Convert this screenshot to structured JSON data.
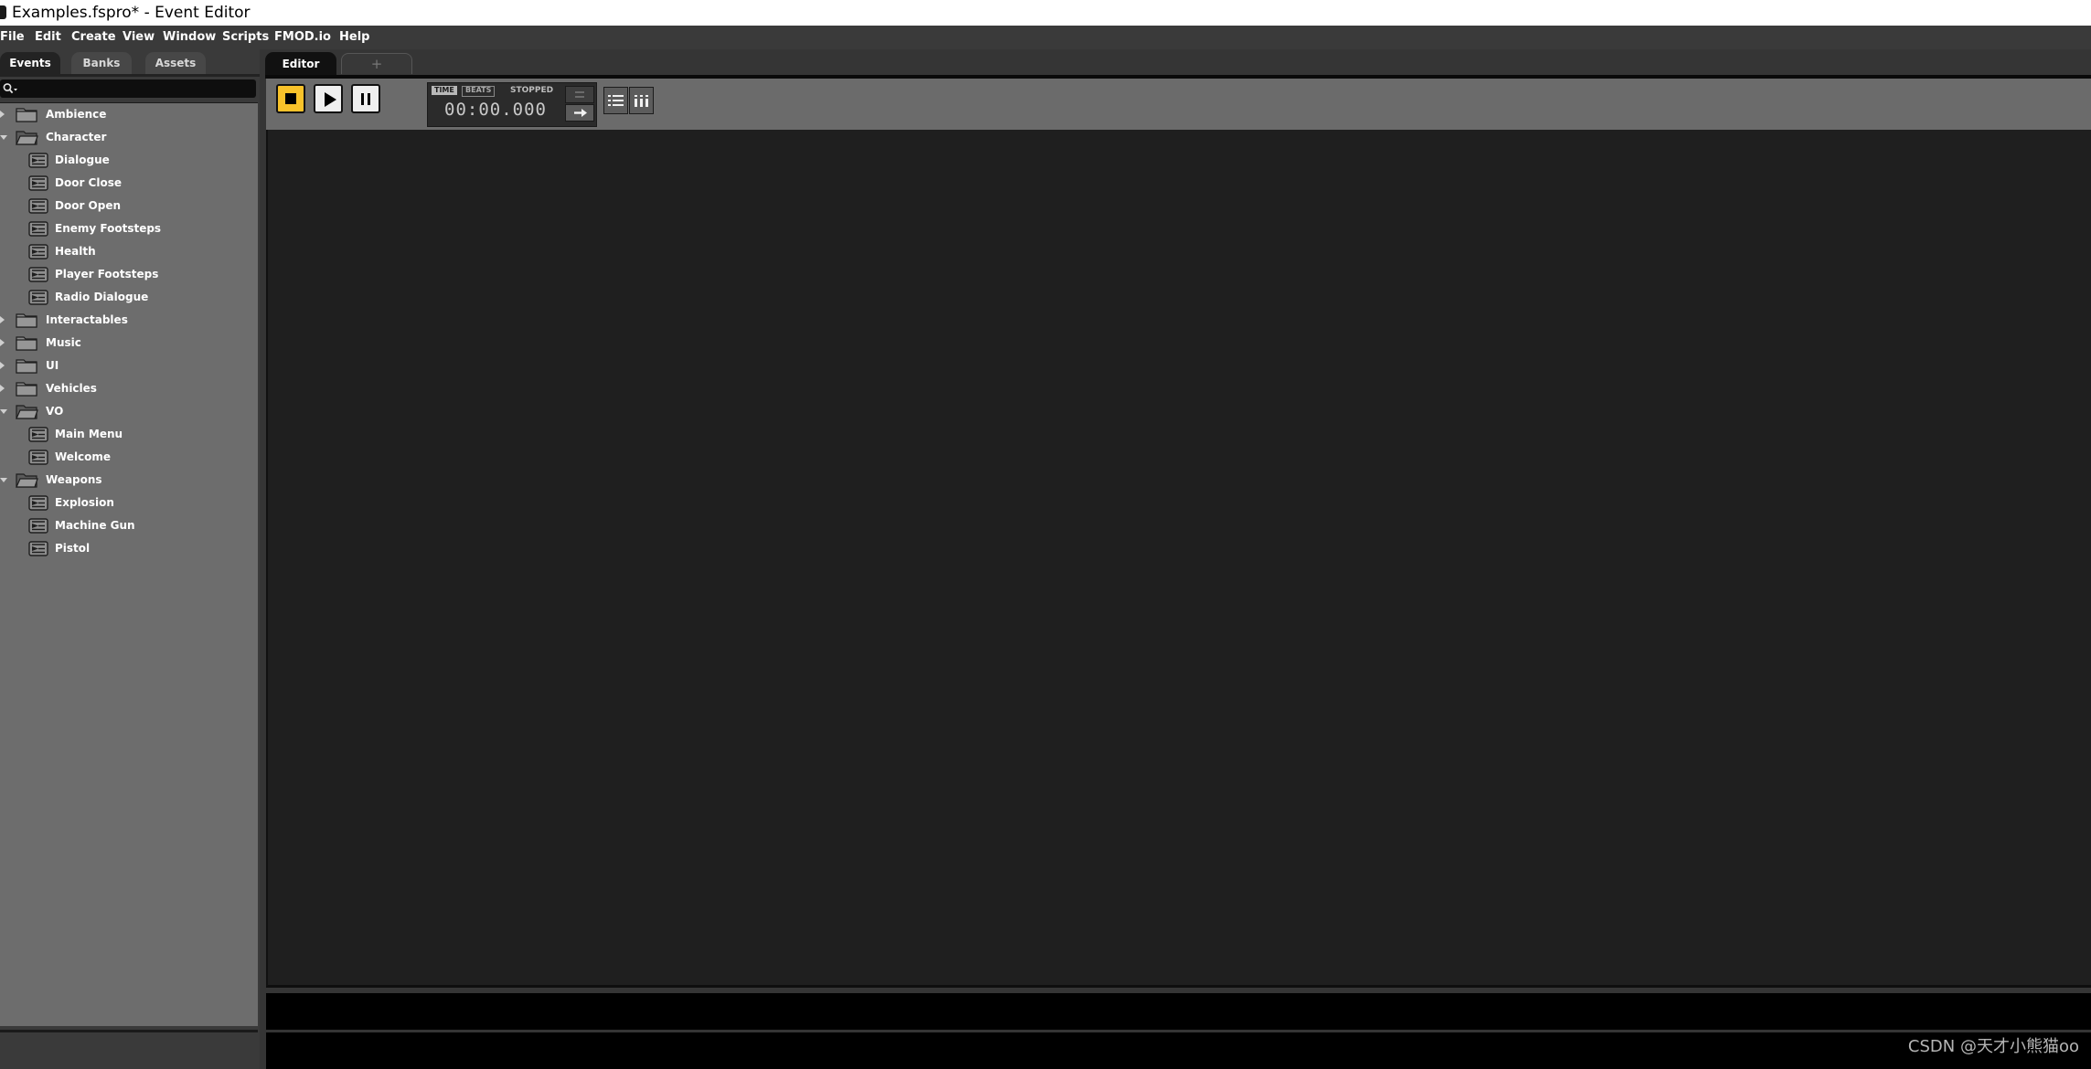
{
  "window": {
    "title": "Examples.fspro* - Event Editor"
  },
  "menu": [
    "File",
    "Edit",
    "Create",
    "View",
    "Window",
    "Scripts",
    "FMOD.io",
    "Help"
  ],
  "browser": {
    "tabs": [
      {
        "label": "Events",
        "active": true
      },
      {
        "label": "Banks",
        "active": false
      },
      {
        "label": "Assets",
        "active": false
      }
    ],
    "search": {
      "value": ""
    },
    "tree": [
      {
        "type": "folder",
        "label": "Ambience",
        "expanded": false
      },
      {
        "type": "folder",
        "label": "Character",
        "expanded": true
      },
      {
        "type": "event",
        "label": "Dialogue"
      },
      {
        "type": "event",
        "label": "Door Close"
      },
      {
        "type": "event",
        "label": "Door Open"
      },
      {
        "type": "event",
        "label": "Enemy Footsteps"
      },
      {
        "type": "event",
        "label": "Health"
      },
      {
        "type": "event",
        "label": "Player Footsteps"
      },
      {
        "type": "event",
        "label": "Radio Dialogue"
      },
      {
        "type": "folder",
        "label": "Interactables",
        "expanded": false
      },
      {
        "type": "folder",
        "label": "Music",
        "expanded": false
      },
      {
        "type": "folder",
        "label": "UI",
        "expanded": false
      },
      {
        "type": "folder",
        "label": "Vehicles",
        "expanded": false
      },
      {
        "type": "folder",
        "label": "VO",
        "expanded": true
      },
      {
        "type": "event",
        "label": "Main Menu"
      },
      {
        "type": "event",
        "label": "Welcome"
      },
      {
        "type": "folder",
        "label": "Weapons",
        "expanded": true
      },
      {
        "type": "event",
        "label": "Explosion"
      },
      {
        "type": "event",
        "label": "Machine Gun"
      },
      {
        "type": "event",
        "label": "Pistol"
      }
    ]
  },
  "editor": {
    "tab_label": "Editor",
    "add_tab_label": "+",
    "transport": {
      "buttons": [
        "stop-icon",
        "play-icon",
        "pause-icon"
      ],
      "time_mode": "TIME",
      "beats_mode": "BEATS",
      "state": "STOPPED",
      "time": "00:00.000"
    },
    "view_buttons": [
      "list-view-icon",
      "columns-view-icon"
    ]
  },
  "watermark": "CSDN @天才小熊猫oo",
  "colors": {
    "stop_button": "#f8c22a",
    "tree_background": "#6d6d6d",
    "canvas_background": "#1f1f1f"
  }
}
